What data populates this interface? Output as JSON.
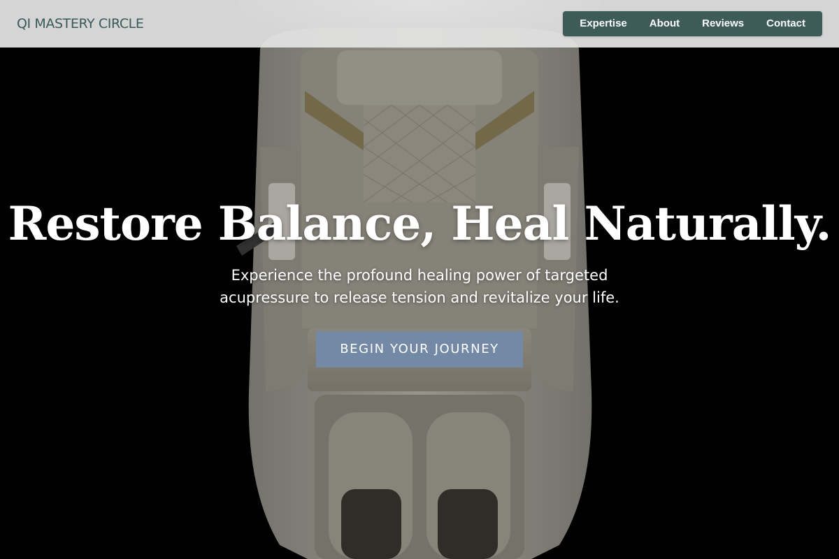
{
  "brand": {
    "name": "QI MASTERY CIRCLE"
  },
  "nav": {
    "links": [
      {
        "label": "Expertise"
      },
      {
        "label": "About"
      },
      {
        "label": "Reviews"
      },
      {
        "label": "Contact"
      }
    ]
  },
  "hero": {
    "title": "Restore Balance, Heal Naturally.",
    "subtitle": "Experience the profound healing power of targeted acupressure to release tension and revitalize your life.",
    "cta_label": "BEGIN YOUR JOURNEY"
  },
  "colors": {
    "nav_bg": "#e2e2e2",
    "nav_pill": "#3d5c59",
    "brand_text": "#3a5a57",
    "cta_bg": "#7389a6",
    "hero_bg": "#000000"
  }
}
